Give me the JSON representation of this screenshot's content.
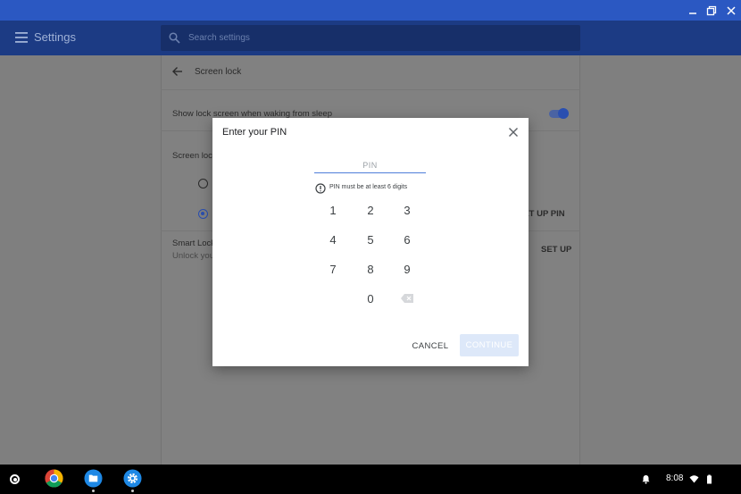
{
  "window": {
    "minimize_icon": "minimize-icon",
    "maximize_icon": "restore-icon",
    "close_icon": "close-icon"
  },
  "appbar": {
    "title": "Settings",
    "search_placeholder": "Search settings"
  },
  "page": {
    "section_title": "Screen lock",
    "rows": {
      "lock_on_wake_label": "Show lock screen when waking from sleep",
      "lock_on_wake_enabled": true,
      "screen_lock_options_label": "Screen lock",
      "setup_pin_link": "SET UP PIN",
      "smart_lock_label": "Smart Lock",
      "smart_lock_desc": "Unlock you",
      "smart_lock_setup_link": "SET UP"
    }
  },
  "dialog": {
    "title": "Enter your PIN",
    "pin_placeholder": "PIN",
    "hint": "PIN must be at least 6 digits",
    "keys": [
      "1",
      "2",
      "3",
      "4",
      "5",
      "6",
      "7",
      "8",
      "9",
      "0"
    ],
    "cancel_label": "CANCEL",
    "continue_label": "CONTINUE",
    "continue_enabled": false
  },
  "shelf": {
    "apps": [
      "chrome",
      "files",
      "settings"
    ],
    "time": "8:08"
  },
  "colors": {
    "title_bar": "#2b58c2",
    "app_bar": "#1c3b84",
    "accent": "#4f7ed9",
    "continue_disabled_bg": "#dde8f9"
  }
}
